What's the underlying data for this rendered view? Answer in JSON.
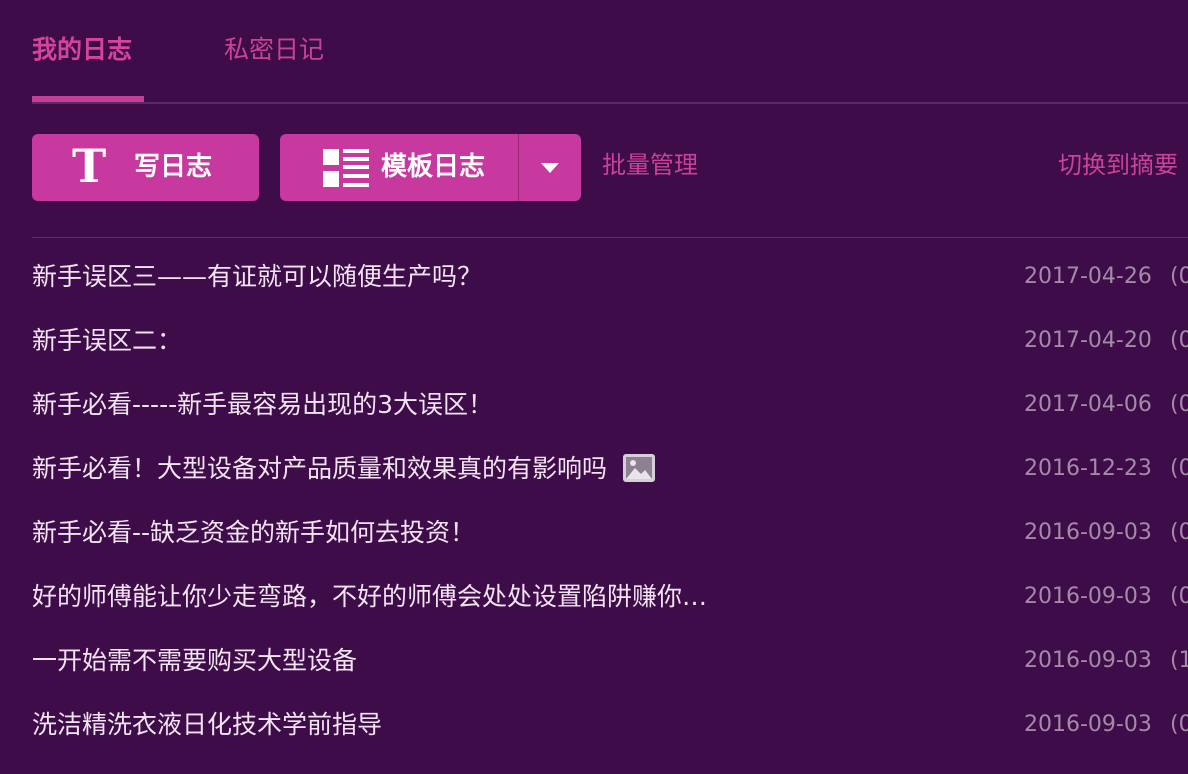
{
  "tabs": {
    "active": "我的日志",
    "inactive": "私密日记"
  },
  "toolbar": {
    "write_icon_glyph": "T",
    "write_label": "写日志",
    "template_label": "模板日志",
    "batch_label": "批量管理",
    "summary_label": "切换到摘要"
  },
  "icons": {
    "write": "text-t-icon",
    "template": "list-icon",
    "dropdown": "caret-down-icon",
    "image": "image-icon"
  },
  "colors": {
    "background": "#3e0c48",
    "accent": "#c8399f",
    "tab_text": "#c9429a",
    "entry_text": "#f2e4f2",
    "date_text": "#a48aa8"
  },
  "entries": [
    {
      "title": "新手误区三——有证就可以随便生产吗？",
      "date": "2017-04-26",
      "count_prefix": "(0",
      "has_image": false
    },
    {
      "title": "新手误区二：",
      "date": "2017-04-20",
      "count_prefix": "(0",
      "has_image": false
    },
    {
      "title": "新手必看-----新手最容易出现的3大误区！",
      "date": "2017-04-06",
      "count_prefix": "(0",
      "has_image": false
    },
    {
      "title": "新手必看！大型设备对产品质量和效果真的有影响吗",
      "date": "2016-12-23",
      "count_prefix": "(0",
      "has_image": true
    },
    {
      "title": "新手必看--缺乏资金的新手如何去投资！",
      "date": "2016-09-03",
      "count_prefix": "(0",
      "has_image": false
    },
    {
      "title": "好的师傅能让你少走弯路，不好的师傅会处处设置陷阱赚你…",
      "date": "2016-09-03",
      "count_prefix": "(0",
      "has_image": false
    },
    {
      "title": "一开始需不需要购买大型设备",
      "date": "2016-09-03",
      "count_prefix": "(1",
      "has_image": false
    },
    {
      "title": "洗洁精洗衣液日化技术学前指导",
      "date": "2016-09-03",
      "count_prefix": "(0",
      "has_image": false
    }
  ]
}
